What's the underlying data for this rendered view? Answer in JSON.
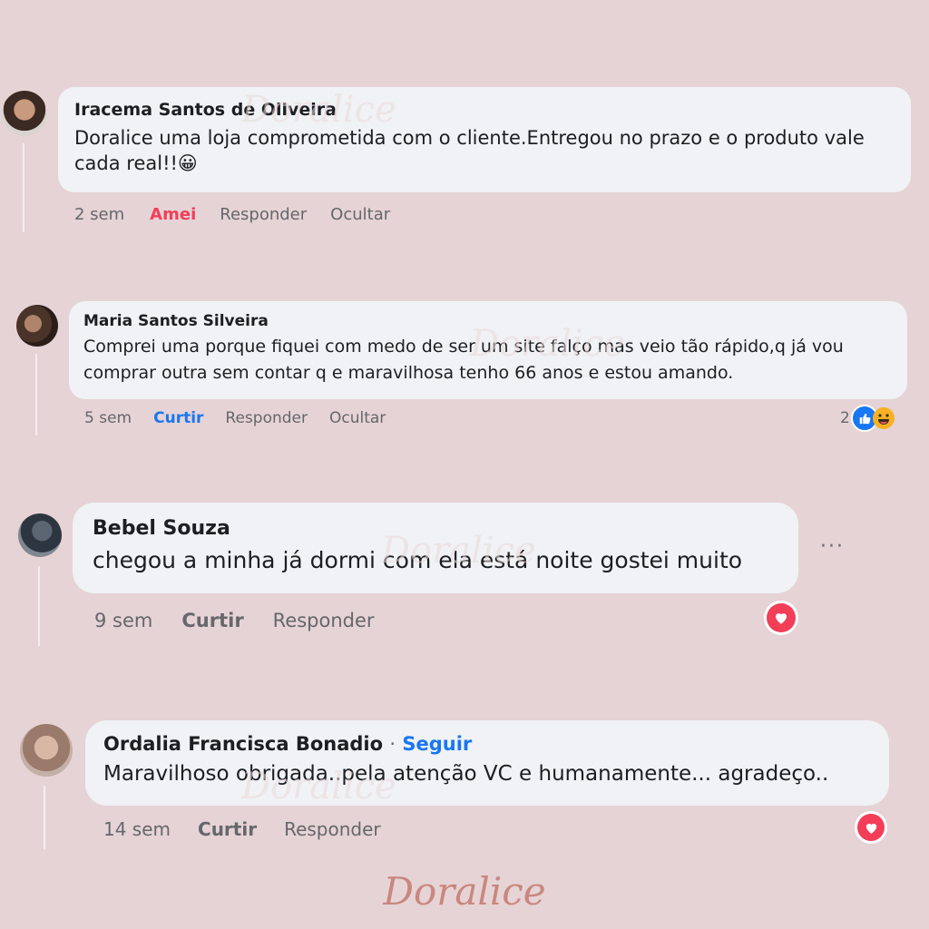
{
  "comments": [
    {
      "author": "Iracema Santos de Oliveira",
      "text": "Doralice uma loja comprometida com o cliente.Entregou no prazo e o produto vale cada real!!",
      "emoji": "😀",
      "time": "2 sem",
      "reaction_action": "Amei",
      "reply": "Responder",
      "hide": "Ocultar"
    },
    {
      "author": "Maria Santos Silveira",
      "text_line1": "Comprei uma porque fiquei com medo de ser um site falço mas veio tão rápido,q já vou",
      "text_line2": "comprar outra sem contar q e maravilhosa tenho 66 anos e estou amando.",
      "time": "5 sem",
      "reaction_action": "Curtir",
      "reply": "Responder",
      "hide": "Ocultar",
      "reaction_count": "2"
    },
    {
      "author": "Bebel Souza",
      "text": "chegou a minha já dormi com ela está noite gostei muito",
      "time": "9 sem",
      "reaction_action": "Curtir",
      "reply": "Responder",
      "more": "···"
    },
    {
      "author": "Ordalia Francisca Bonadio",
      "separator": "·",
      "follow": "Seguir",
      "text": "Maravilhoso obrigada..pela atenção VC e humanamente... agradeço..",
      "time": "14 sem",
      "reaction_action": "Curtir",
      "reply": "Responder"
    }
  ],
  "watermark": "Doralice",
  "brand": "Doralice",
  "colors": {
    "background": "#e6d3d6",
    "bubble": "#f0f2f5",
    "love": "#f33e58",
    "like": "#1877f2",
    "brand": "#c9877d"
  }
}
